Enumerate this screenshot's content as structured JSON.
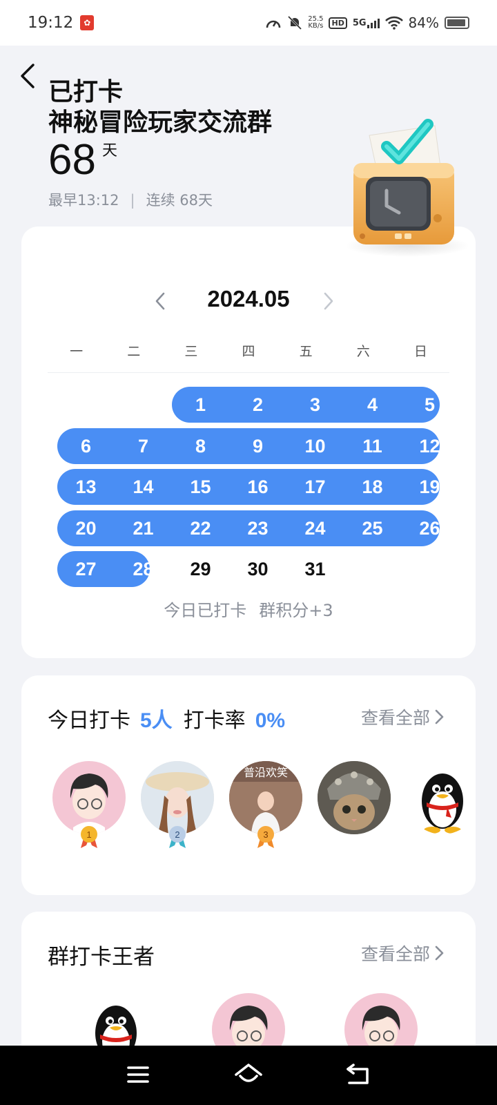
{
  "status_bar": {
    "time": "19:12",
    "net_speed_value": "25.5",
    "net_speed_unit": "KB/s",
    "hd_label": "HD",
    "signal_label": "5G",
    "battery": "84%"
  },
  "header": {
    "title_line1": "已打卡",
    "title_line2": "神秘冒险玩家交流群",
    "days_count": "68",
    "days_unit": "天",
    "earliest": "最早13:12",
    "separator": "|",
    "streak": "连续 68天"
  },
  "calendar": {
    "month": "2024.05",
    "weekdays": [
      "一",
      "二",
      "三",
      "四",
      "五",
      "六",
      "日"
    ],
    "status_left": "今日已打卡",
    "status_right": "群积分+3",
    "checked_color": "#4a8ef4"
  },
  "today": {
    "title": "今日打卡",
    "count": "5人",
    "rate_label": "打卡率",
    "rate_value": "0%",
    "see_all": "查看全部",
    "medals": [
      "1",
      "2",
      "3"
    ]
  },
  "king": {
    "title": "群打卡王者",
    "see_all": "查看全部"
  }
}
